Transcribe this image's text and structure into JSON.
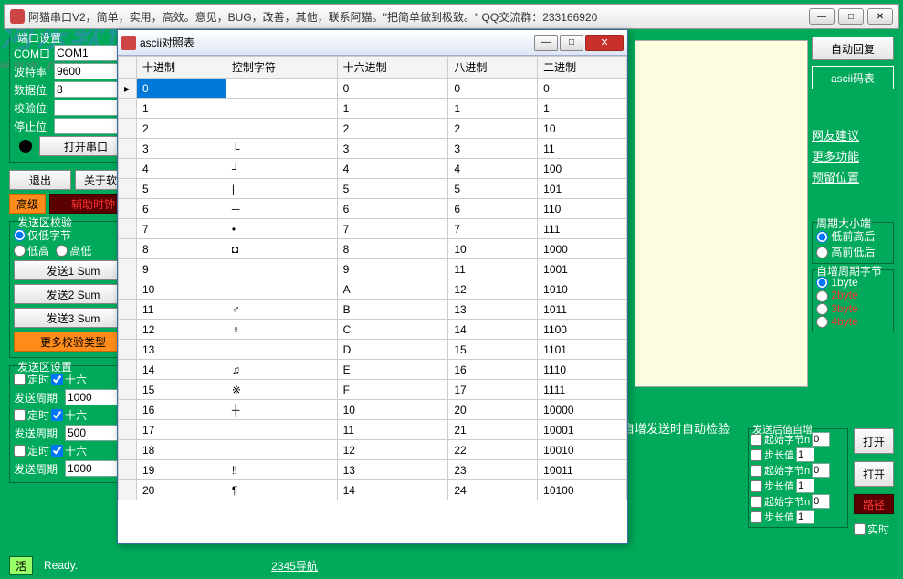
{
  "main_title": "阿猫串口V2，简单，实用，高效。意见，BUG，改善，其他，联系阿猫。\"把简单做到极致。\" QQ交流群：233166920",
  "watermark": {
    "main": "河东软件园",
    "sub": "www.pc0359.cn"
  },
  "port_settings": {
    "legend": "端口设置",
    "com_label": "COM口",
    "com_value": "COM1",
    "baud_label": "波特率",
    "baud_value": "9600",
    "databits_label": "数据位",
    "databits_value": "8",
    "parity_label": "校验位",
    "parity_value": "",
    "stopbits_label": "停止位",
    "stopbits_value": "",
    "open_label": "打开串口"
  },
  "buttons": {
    "exit": "退出",
    "about": "关于软件",
    "advanced": "高级",
    "aux": "辅助时钟"
  },
  "checksum": {
    "legend": "发送区校验",
    "low_only": "仅低字节",
    "low": "低高",
    "high": "高低",
    "send1": "发送1 Sum",
    "send2": "发送2 Sum",
    "send3": "发送3 Sum",
    "more": "更多校验类型"
  },
  "send_area": {
    "legend": "发送区设置",
    "timed": "定时",
    "hex": "十六",
    "cycle_label": "发送周期",
    "rows": [
      {
        "cycle": "1000"
      },
      {
        "cycle": "500"
      },
      {
        "cycle": "1000"
      }
    ]
  },
  "right": {
    "auto_reply": "自动回复",
    "ascii_btn": "ascii码表",
    "links": [
      "网友建议",
      "更多功能",
      "预留位置"
    ],
    "endian": {
      "legend": "周期大小端",
      "low_first": "低前高后",
      "high_first": "高前低后"
    },
    "inc_bytes": {
      "legend": "自增周期字节",
      "opts": [
        "1byte",
        "2byte",
        "3byte",
        "4byte"
      ]
    }
  },
  "auto_inc": {
    "header": "自增发送时自动检验",
    "col_header": "发送后值自增",
    "start_byte": "起始字节n",
    "step": "步长值",
    "open": "打开",
    "path": "路径",
    "realtime": "实时",
    "values": [
      {
        "start": "0",
        "step": "1"
      },
      {
        "start": "0",
        "step": "1"
      },
      {
        "start": "0",
        "step": "1"
      }
    ]
  },
  "status": {
    "live": "活",
    "ready": "Ready.",
    "nav": "2345导航"
  },
  "dialog": {
    "title": "ascii对照表",
    "headers": [
      "十进制",
      "控制字符",
      "十六进制",
      "八进制",
      "二进制"
    ],
    "rows": [
      [
        "0",
        "",
        "0",
        "0",
        "0"
      ],
      [
        "1",
        "",
        "1",
        "1",
        "1"
      ],
      [
        "2",
        "",
        "2",
        "2",
        "10"
      ],
      [
        "3",
        "└",
        "3",
        "3",
        "11"
      ],
      [
        "4",
        "┘",
        "4",
        "4",
        "100"
      ],
      [
        "5",
        "|",
        "5",
        "5",
        "101"
      ],
      [
        "6",
        "─",
        "6",
        "6",
        "110"
      ],
      [
        "7",
        "•",
        "7",
        "7",
        "111"
      ],
      [
        "8",
        "◘",
        "8",
        "10",
        "1000"
      ],
      [
        "9",
        "",
        "9",
        "11",
        "1001"
      ],
      [
        "10",
        "",
        "A",
        "12",
        "1010"
      ],
      [
        "11",
        "♂",
        "B",
        "13",
        "1011"
      ],
      [
        "12",
        "♀",
        "C",
        "14",
        "1100"
      ],
      [
        "13",
        "",
        "D",
        "15",
        "1101"
      ],
      [
        "14",
        "♫",
        "E",
        "16",
        "1110"
      ],
      [
        "15",
        "※",
        "F",
        "17",
        "1111"
      ],
      [
        "16",
        "┼",
        "10",
        "20",
        "10000"
      ],
      [
        "17",
        "",
        "11",
        "21",
        "10001"
      ],
      [
        "18",
        "",
        "12",
        "22",
        "10010"
      ],
      [
        "19",
        "‼",
        "13",
        "23",
        "10011"
      ],
      [
        "20",
        "¶",
        "14",
        "24",
        "10100"
      ]
    ]
  }
}
